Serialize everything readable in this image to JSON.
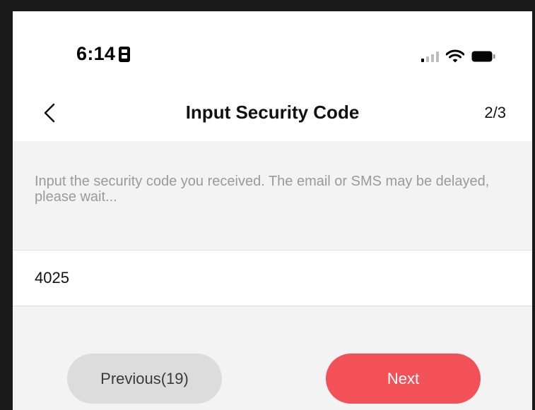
{
  "status_bar": {
    "time": "6:14"
  },
  "nav": {
    "title": "Input Security Code",
    "step": "2/3"
  },
  "instruction": "Input the security code you received. The email or SMS may be delayed, please wait...",
  "code_field": {
    "value": "4025"
  },
  "buttons": {
    "previous_label": "Previous(19)",
    "next_label": "Next"
  },
  "colors": {
    "accent": "#f25157",
    "secondary_button": "#dcdcdc",
    "background": "#f3f3f3",
    "hint_text": "#9a9a9a"
  },
  "icons": {
    "back": "chevron-left-icon",
    "signal": "signal-icon",
    "wifi": "wifi-icon",
    "battery": "battery-icon",
    "id_card": "id-card-icon"
  }
}
